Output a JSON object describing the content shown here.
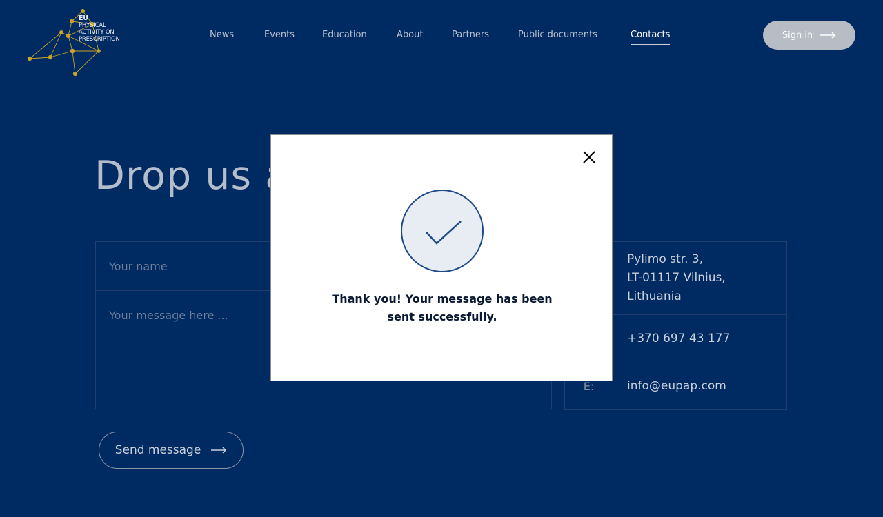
{
  "brand": {
    "logo_line1": "EU",
    "logo_line2": "PHYSICAL",
    "logo_line3": "ACTIVITY ON",
    "logo_line4": "PRESCRIPTION",
    "accent_color": "#c9a227"
  },
  "nav": {
    "items": [
      {
        "label": "News"
      },
      {
        "label": "Events"
      },
      {
        "label": "Education"
      },
      {
        "label": "About"
      },
      {
        "label": "Partners"
      },
      {
        "label": "Public documents"
      },
      {
        "label": "Contacts",
        "active": true
      }
    ],
    "signin_label": "Sign in"
  },
  "page": {
    "heading": "Drop us a line"
  },
  "form": {
    "name_placeholder": "Your name",
    "message_placeholder": "Your message here ...",
    "send_label": "Send message"
  },
  "contacts": {
    "address_line1": "Pylimo str. 3,",
    "address_line2": "LT-01117 Vilnius,",
    "address_line3": "Lithuania",
    "phone": "+370 697 43 177",
    "email_label": "E:",
    "email": "info@eupap.com"
  },
  "modal": {
    "message_line1": "Thank you! Your message has been",
    "message_line2": "sent successfully.",
    "icons": [
      "check-icon",
      "close-icon"
    ]
  },
  "colors": {
    "background": "#002a62",
    "modal_bg": "#ffffff",
    "check_color": "#1d4a86"
  }
}
